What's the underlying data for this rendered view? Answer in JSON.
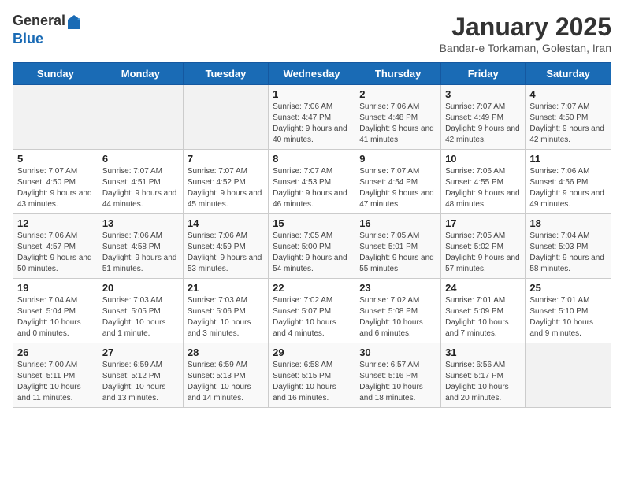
{
  "header": {
    "logo_general": "General",
    "logo_blue": "Blue",
    "month_title": "January 2025",
    "subtitle": "Bandar-e Torkaman, Golestan, Iran"
  },
  "weekdays": [
    "Sunday",
    "Monday",
    "Tuesday",
    "Wednesday",
    "Thursday",
    "Friday",
    "Saturday"
  ],
  "weeks": [
    [
      {
        "day": "",
        "sunrise": "",
        "sunset": "",
        "daylight": ""
      },
      {
        "day": "",
        "sunrise": "",
        "sunset": "",
        "daylight": ""
      },
      {
        "day": "",
        "sunrise": "",
        "sunset": "",
        "daylight": ""
      },
      {
        "day": "1",
        "sunrise": "Sunrise: 7:06 AM",
        "sunset": "Sunset: 4:47 PM",
        "daylight": "Daylight: 9 hours and 40 minutes."
      },
      {
        "day": "2",
        "sunrise": "Sunrise: 7:06 AM",
        "sunset": "Sunset: 4:48 PM",
        "daylight": "Daylight: 9 hours and 41 minutes."
      },
      {
        "day": "3",
        "sunrise": "Sunrise: 7:07 AM",
        "sunset": "Sunset: 4:49 PM",
        "daylight": "Daylight: 9 hours and 42 minutes."
      },
      {
        "day": "4",
        "sunrise": "Sunrise: 7:07 AM",
        "sunset": "Sunset: 4:50 PM",
        "daylight": "Daylight: 9 hours and 42 minutes."
      }
    ],
    [
      {
        "day": "5",
        "sunrise": "Sunrise: 7:07 AM",
        "sunset": "Sunset: 4:50 PM",
        "daylight": "Daylight: 9 hours and 43 minutes."
      },
      {
        "day": "6",
        "sunrise": "Sunrise: 7:07 AM",
        "sunset": "Sunset: 4:51 PM",
        "daylight": "Daylight: 9 hours and 44 minutes."
      },
      {
        "day": "7",
        "sunrise": "Sunrise: 7:07 AM",
        "sunset": "Sunset: 4:52 PM",
        "daylight": "Daylight: 9 hours and 45 minutes."
      },
      {
        "day": "8",
        "sunrise": "Sunrise: 7:07 AM",
        "sunset": "Sunset: 4:53 PM",
        "daylight": "Daylight: 9 hours and 46 minutes."
      },
      {
        "day": "9",
        "sunrise": "Sunrise: 7:07 AM",
        "sunset": "Sunset: 4:54 PM",
        "daylight": "Daylight: 9 hours and 47 minutes."
      },
      {
        "day": "10",
        "sunrise": "Sunrise: 7:06 AM",
        "sunset": "Sunset: 4:55 PM",
        "daylight": "Daylight: 9 hours and 48 minutes."
      },
      {
        "day": "11",
        "sunrise": "Sunrise: 7:06 AM",
        "sunset": "Sunset: 4:56 PM",
        "daylight": "Daylight: 9 hours and 49 minutes."
      }
    ],
    [
      {
        "day": "12",
        "sunrise": "Sunrise: 7:06 AM",
        "sunset": "Sunset: 4:57 PM",
        "daylight": "Daylight: 9 hours and 50 minutes."
      },
      {
        "day": "13",
        "sunrise": "Sunrise: 7:06 AM",
        "sunset": "Sunset: 4:58 PM",
        "daylight": "Daylight: 9 hours and 51 minutes."
      },
      {
        "day": "14",
        "sunrise": "Sunrise: 7:06 AM",
        "sunset": "Sunset: 4:59 PM",
        "daylight": "Daylight: 9 hours and 53 minutes."
      },
      {
        "day": "15",
        "sunrise": "Sunrise: 7:05 AM",
        "sunset": "Sunset: 5:00 PM",
        "daylight": "Daylight: 9 hours and 54 minutes."
      },
      {
        "day": "16",
        "sunrise": "Sunrise: 7:05 AM",
        "sunset": "Sunset: 5:01 PM",
        "daylight": "Daylight: 9 hours and 55 minutes."
      },
      {
        "day": "17",
        "sunrise": "Sunrise: 7:05 AM",
        "sunset": "Sunset: 5:02 PM",
        "daylight": "Daylight: 9 hours and 57 minutes."
      },
      {
        "day": "18",
        "sunrise": "Sunrise: 7:04 AM",
        "sunset": "Sunset: 5:03 PM",
        "daylight": "Daylight: 9 hours and 58 minutes."
      }
    ],
    [
      {
        "day": "19",
        "sunrise": "Sunrise: 7:04 AM",
        "sunset": "Sunset: 5:04 PM",
        "daylight": "Daylight: 10 hours and 0 minutes."
      },
      {
        "day": "20",
        "sunrise": "Sunrise: 7:03 AM",
        "sunset": "Sunset: 5:05 PM",
        "daylight": "Daylight: 10 hours and 1 minute."
      },
      {
        "day": "21",
        "sunrise": "Sunrise: 7:03 AM",
        "sunset": "Sunset: 5:06 PM",
        "daylight": "Daylight: 10 hours and 3 minutes."
      },
      {
        "day": "22",
        "sunrise": "Sunrise: 7:02 AM",
        "sunset": "Sunset: 5:07 PM",
        "daylight": "Daylight: 10 hours and 4 minutes."
      },
      {
        "day": "23",
        "sunrise": "Sunrise: 7:02 AM",
        "sunset": "Sunset: 5:08 PM",
        "daylight": "Daylight: 10 hours and 6 minutes."
      },
      {
        "day": "24",
        "sunrise": "Sunrise: 7:01 AM",
        "sunset": "Sunset: 5:09 PM",
        "daylight": "Daylight: 10 hours and 7 minutes."
      },
      {
        "day": "25",
        "sunrise": "Sunrise: 7:01 AM",
        "sunset": "Sunset: 5:10 PM",
        "daylight": "Daylight: 10 hours and 9 minutes."
      }
    ],
    [
      {
        "day": "26",
        "sunrise": "Sunrise: 7:00 AM",
        "sunset": "Sunset: 5:11 PM",
        "daylight": "Daylight: 10 hours and 11 minutes."
      },
      {
        "day": "27",
        "sunrise": "Sunrise: 6:59 AM",
        "sunset": "Sunset: 5:12 PM",
        "daylight": "Daylight: 10 hours and 13 minutes."
      },
      {
        "day": "28",
        "sunrise": "Sunrise: 6:59 AM",
        "sunset": "Sunset: 5:13 PM",
        "daylight": "Daylight: 10 hours and 14 minutes."
      },
      {
        "day": "29",
        "sunrise": "Sunrise: 6:58 AM",
        "sunset": "Sunset: 5:15 PM",
        "daylight": "Daylight: 10 hours and 16 minutes."
      },
      {
        "day": "30",
        "sunrise": "Sunrise: 6:57 AM",
        "sunset": "Sunset: 5:16 PM",
        "daylight": "Daylight: 10 hours and 18 minutes."
      },
      {
        "day": "31",
        "sunrise": "Sunrise: 6:56 AM",
        "sunset": "Sunset: 5:17 PM",
        "daylight": "Daylight: 10 hours and 20 minutes."
      },
      {
        "day": "",
        "sunrise": "",
        "sunset": "",
        "daylight": ""
      }
    ]
  ]
}
